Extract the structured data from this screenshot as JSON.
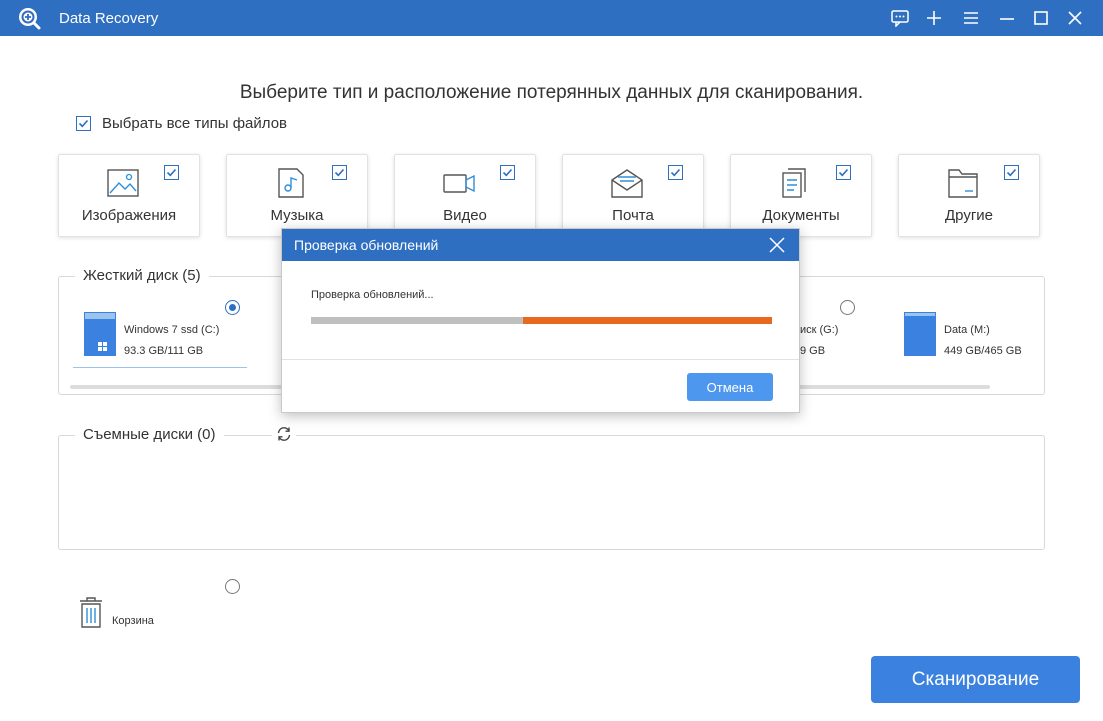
{
  "app": {
    "title": "Data Recovery",
    "icons": [
      "app-logo-icon",
      "feedback-icon",
      "plus-icon",
      "menu-icon",
      "minimize-icon",
      "maximize-icon",
      "close-icon"
    ]
  },
  "main": {
    "heading": "Выберите тип и расположение потерянных данных для сканирования.",
    "select_all_label": "Выбрать все типы файлов",
    "file_types": [
      {
        "label": "Изображения",
        "icon": "image-icon",
        "checked": true
      },
      {
        "label": "Музыка",
        "icon": "music-icon",
        "checked": true
      },
      {
        "label": "Видео",
        "icon": "video-icon",
        "checked": true
      },
      {
        "label": "Почта",
        "icon": "mail-icon",
        "checked": true
      },
      {
        "label": "Документы",
        "icon": "documents-icon",
        "checked": true
      },
      {
        "label": "Другие",
        "icon": "folder-icon",
        "checked": true
      }
    ]
  },
  "hard_disks": {
    "title": "Жесткий диск (5)",
    "drives": [
      {
        "name": "Windows 7 ssd (C:)",
        "size": "93.3 GB/111 GB",
        "selected": true
      },
      {
        "name": "иск (G:)",
        "size": "9 GB",
        "selected": false
      },
      {
        "name": "Data (M:)",
        "size": "449 GB/465 GB",
        "selected": false
      }
    ]
  },
  "removable": {
    "title": "Съемные диски (0)"
  },
  "recycle": {
    "label": "Корзина"
  },
  "scan_button": "Сканирование",
  "dialog": {
    "title": "Проверка обновлений",
    "message": "Проверка обновлений...",
    "progress_segments": [
      {
        "color": "#bfbfbf",
        "from": 0,
        "to": 0.46
      },
      {
        "color": "#e8681e",
        "from": 0.46,
        "to": 1.0
      }
    ],
    "cancel_label": "Отмена"
  },
  "colors": {
    "accent": "#2f6fc1",
    "scan_button": "#3b82e0",
    "progress_orange": "#e8681e",
    "progress_gray": "#bfbfbf"
  }
}
